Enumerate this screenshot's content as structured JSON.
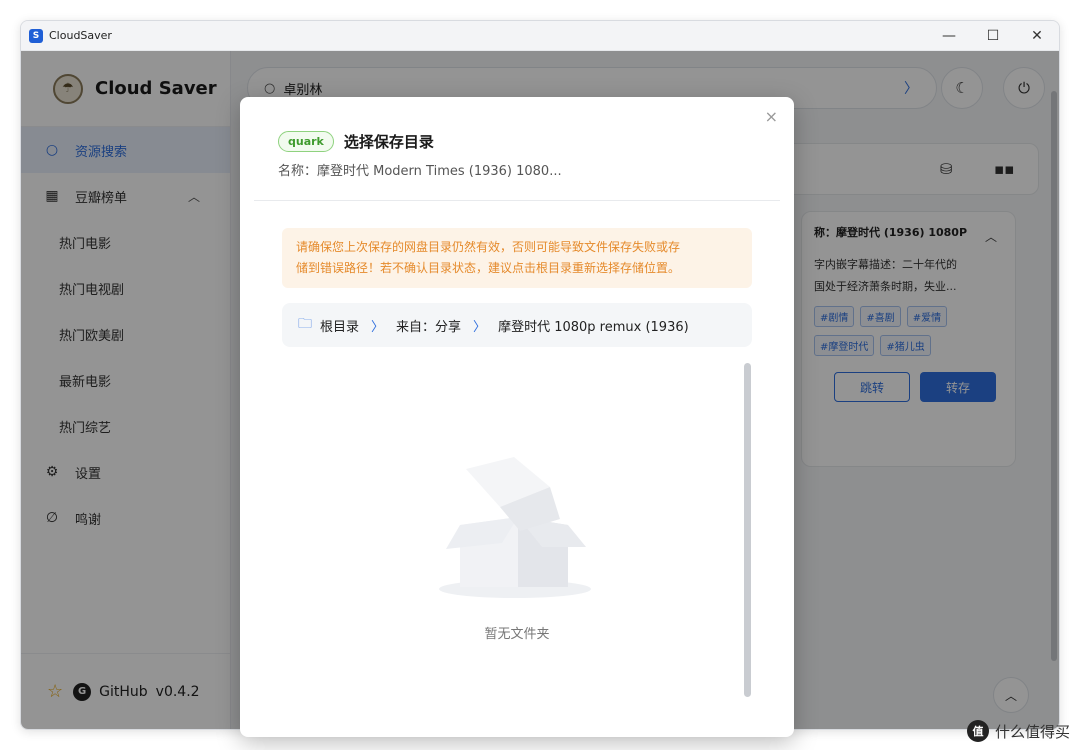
{
  "window": {
    "title": "CloudSaver",
    "controls": {
      "minimize": "—",
      "maximize": "☐",
      "close": "✕"
    }
  },
  "sidebar": {
    "brand": "Cloud Saver",
    "items": [
      {
        "label": "资源搜索",
        "icon": "search-icon"
      },
      {
        "label": "豆瓣榜单",
        "icon": "film-icon"
      }
    ],
    "sub_items": [
      "热门电影",
      "热门电视剧",
      "热门欧美剧",
      "最新电影",
      "热门综艺"
    ],
    "settings": "设置",
    "thanks": "鸣谢",
    "footer": {
      "github": "GitHub",
      "version": "v0.4.2"
    }
  },
  "search": {
    "value": "卓别林"
  },
  "result_card": {
    "title": "称：摩登时代 (1936) 1080P",
    "desc_line1": "字内嵌字幕描述：二十年代的",
    "desc_line2": "国处于经济萧条时期，失业...",
    "tags_row1": [
      "#剧情",
      "#喜剧",
      "#爱情"
    ],
    "tags_row2": [
      "#摩登时代",
      "#猪儿虫"
    ],
    "jump_label": "跳转",
    "save_label": "转存"
  },
  "modal": {
    "tag": "quark",
    "title": "选择保存目录",
    "subtitle": "名称：摩登时代 Modern Times (1936) 1080...",
    "warning_line1": "请确保您上次保存的网盘目录仍然有效，否则可能导致文件保存失败或存",
    "warning_line2": "储到错误路径！若不确认目录状态，建议点击根目录重新选择存储位置。",
    "breadcrumb": [
      "根目录",
      "来自：分享",
      "摩登时代 1080p remux (1936)"
    ],
    "empty": "暂无文件夹",
    "close": "×"
  },
  "watermark": "什么值得买",
  "colors": {
    "accent": "#2f6fde",
    "warning": "#e58a2b",
    "quark": "#3f9b2e"
  }
}
